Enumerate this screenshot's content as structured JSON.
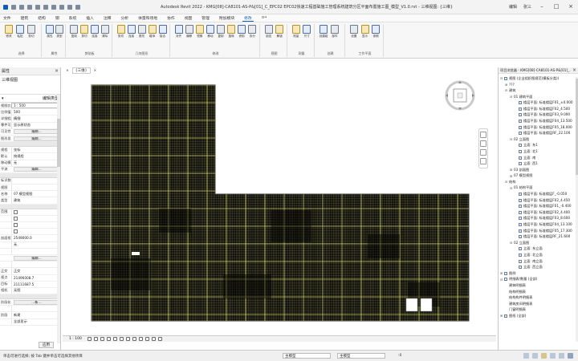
{
  "window": {
    "title": "Autodesk Revit 2022 - KMG[08]-CA8101-AS-P&[01]_C_EPC02 EPC02快速工程基础施工管理系统建筑分区平面布置施工图_模型_V1.0.rvt - 三维视图: {三维}",
    "user": "编辑",
    "user_name": "张三",
    "min": "–",
    "max": "□",
    "close": "×"
  },
  "tabs": [
    "文件",
    "建筑",
    "结构",
    "钢",
    "系统",
    "插入",
    "注释",
    "分析",
    "体量和场地",
    "协作",
    "视图",
    "管理",
    "附加模块",
    "修改",
    "⊙•"
  ],
  "active_tab": "修改",
  "ribbon": {
    "groups": [
      {
        "label": "选择",
        "buttons": [
          "修改",
          "粘贴",
          "剪切"
        ]
      },
      {
        "label": "属性",
        "buttons": [
          "属性",
          "类型"
        ]
      },
      {
        "label": "剪贴板",
        "buttons": [
          "复制",
          "剪切",
          "连接",
          "清除"
        ]
      },
      {
        "label": "几何图形",
        "buttons": [
          "剪切",
          "连接",
          "更改",
          "增添",
          "接合"
        ]
      },
      {
        "label": "修改",
        "buttons": [
          "对齐",
          "偏移",
          "镜像",
          "移动",
          "复制",
          "旋转",
          "修剪",
          "拆分"
        ]
      },
      {
        "label": "视图",
        "buttons": [
          "锁定",
          "解锁"
        ]
      },
      {
        "label": "测量",
        "buttons": [
          "测量",
          "尺寸"
        ]
      },
      {
        "label": "创建",
        "buttons": [
          "创建组",
          "部件"
        ]
      },
      {
        "label": "工作平面",
        "buttons": [
          "设置",
          "显示",
          "参照"
        ]
      }
    ]
  },
  "properties_panel": {
    "title": "属性",
    "type_label": "三维视图",
    "edit_type": "编辑类型",
    "rows": [
      {
        "k": "视图比例",
        "v": "1 : 500",
        "kind": "box"
      },
      {
        "k": "比例值",
        "v": "500",
        "kind": "text"
      },
      {
        "k": "详细程度",
        "v": "精细",
        "kind": "text"
      },
      {
        "k": "零件可见性",
        "v": "显示原状态",
        "kind": "text"
      },
      {
        "k": "可见性",
        "v": "编辑...",
        "kind": "btn"
      },
      {
        "k": "图形显示",
        "v": "编辑...",
        "kind": "btn"
      },
      {
        "k": "",
        "v": "",
        "kind": "section"
      },
      {
        "k": "规程",
        "v": "坐标",
        "kind": "text"
      },
      {
        "k": "默认",
        "v": "按规程",
        "kind": "text"
      },
      {
        "k": "移动模式",
        "v": "无",
        "kind": "text"
      },
      {
        "k": "平流",
        "v": "编辑...",
        "kind": "btn"
      },
      {
        "k": "",
        "v": "",
        "kind": "section"
      },
      {
        "k": "标识数据",
        "v": "",
        "kind": "text"
      },
      {
        "k": "视图",
        "v": "",
        "kind": "text"
      },
      {
        "k": "名称",
        "v": "07 模型视图",
        "kind": "text"
      },
      {
        "k": "类型",
        "v": "建筑",
        "kind": "text"
      },
      {
        "k": "",
        "v": "",
        "kind": "section"
      },
      {
        "k": "范围",
        "v": "",
        "kind": "chk"
      },
      {
        "k": "",
        "v": "",
        "kind": "chk"
      },
      {
        "k": "",
        "v": "",
        "kind": "chk"
      },
      {
        "k": "",
        "v": "",
        "kind": "chk"
      },
      {
        "k": "剖面框",
        "v": "2549000.0",
        "kind": "text"
      },
      {
        "k": "",
        "v": "无",
        "kind": "text"
      },
      {
        "k": "",
        "v": "",
        "kind": "text"
      },
      {
        "k": "",
        "v": "编辑...",
        "kind": "btn"
      },
      {
        "k": "",
        "v": "",
        "kind": "text"
      },
      {
        "k": "正交",
        "v": "正交",
        "kind": "text"
      },
      {
        "k": "视点",
        "v": "21496008.7",
        "kind": "text"
      },
      {
        "k": "目标",
        "v": "21111687.5",
        "kind": "text"
      },
      {
        "k": "相机",
        "v": "无图",
        "kind": "text"
      },
      {
        "k": "",
        "v": "",
        "kind": "section"
      },
      {
        "k": "阶段化",
        "v": "…新…",
        "kind": "btn"
      },
      {
        "k": "",
        "v": "",
        "kind": "text"
      },
      {
        "k": "阶段",
        "v": "新建",
        "kind": "text"
      },
      {
        "k": "",
        "v": "全部显示",
        "kind": "text"
      }
    ],
    "apply": "应用"
  },
  "view_tabs": [
    "×",
    "{三维}",
    "×"
  ],
  "project_browser": {
    "title": "项目浏览器 - KMG[08]-CA8101-AS-P&[01]_...",
    "items": [
      {
        "t": "视图 (企业组织图规范(模板分类))",
        "lvl": 0,
        "tw": "⊟"
      },
      {
        "t": "???",
        "lvl": 1,
        "tw": "⊞"
      },
      {
        "t": "建筑",
        "lvl": 1,
        "tw": "⊟"
      },
      {
        "t": "01 建筑平面",
        "lvl": 2,
        "tw": "⊟"
      },
      {
        "t": "楼层平面: 标准楼层F01_±0.000",
        "lvl": 3,
        "tw": ""
      },
      {
        "t": "楼层平面: 标准楼层F02_4.500",
        "lvl": 3,
        "tw": ""
      },
      {
        "t": "楼层平面: 标准楼层F03_9.000",
        "lvl": 3,
        "tw": ""
      },
      {
        "t": "楼层平面: 标准楼层F04_13.500",
        "lvl": 3,
        "tw": ""
      },
      {
        "t": "楼层平面: 标准楼层F05_18.000",
        "lvl": 3,
        "tw": ""
      },
      {
        "t": "楼层平面: 标准楼层RF_22.100",
        "lvl": 3,
        "tw": ""
      },
      {
        "t": "02 立面图",
        "lvl": 2,
        "tw": "⊟"
      },
      {
        "t": "立面: 东1",
        "lvl": 3,
        "tw": ""
      },
      {
        "t": "立面: 北1",
        "lvl": 3,
        "tw": ""
      },
      {
        "t": "立面: 南",
        "lvl": 3,
        "tw": ""
      },
      {
        "t": "立面: 西1",
        "lvl": 3,
        "tw": ""
      },
      {
        "t": "03 剖面图",
        "lvl": 2,
        "tw": "⊞"
      },
      {
        "t": "07 模型视图",
        "lvl": 2,
        "tw": "⊞"
      },
      {
        "t": "结构",
        "lvl": 1,
        "tw": "⊟"
      },
      {
        "t": "01 结构平面",
        "lvl": 2,
        "tw": "⊟"
      },
      {
        "t": "楼层平面: 标准楼层F_-0.050",
        "lvl": 3,
        "tw": ""
      },
      {
        "t": "楼层平面: 标准楼层F02_4.450",
        "lvl": 3,
        "tw": ""
      },
      {
        "t": "楼层平面: 标准楼层F01_-0.400",
        "lvl": 3,
        "tw": ""
      },
      {
        "t": "楼层平面: 标准楼层F02_4.400",
        "lvl": 3,
        "tw": ""
      },
      {
        "t": "楼层平面: 标准楼层F03_8.600",
        "lvl": 3,
        "tw": ""
      },
      {
        "t": "楼层平面: 标准楼层F04_13.100",
        "lvl": 3,
        "tw": ""
      },
      {
        "t": "楼层平面: 标准楼层F05_17.300",
        "lvl": 3,
        "tw": ""
      },
      {
        "t": "楼层平面: 标准楼层RF_21.600",
        "lvl": 3,
        "tw": ""
      },
      {
        "t": "02 立面图",
        "lvl": 2,
        "tw": "⊟"
      },
      {
        "t": "立面: 东立面",
        "lvl": 3,
        "tw": ""
      },
      {
        "t": "立面: 北立面",
        "lvl": 3,
        "tw": ""
      },
      {
        "t": "立面: 南立面",
        "lvl": 3,
        "tw": ""
      },
      {
        "t": "立面: 西立面",
        "lvl": 3,
        "tw": ""
      },
      {
        "t": "图例",
        "lvl": 0,
        "tw": "⊞"
      },
      {
        "t": "明细表/数量 (全部)",
        "lvl": 0,
        "tw": "⊟"
      },
      {
        "t": "建筑明细表",
        "lvl": 1,
        "tw": ""
      },
      {
        "t": "结构明细表",
        "lvl": 1,
        "tw": ""
      },
      {
        "t": "结构构件明细表",
        "lvl": 1,
        "tw": ""
      },
      {
        "t": "建筑房间明细表",
        "lvl": 1,
        "tw": ""
      },
      {
        "t": "门窗明细表",
        "lvl": 1,
        "tw": ""
      },
      {
        "t": "图纸 (全部)",
        "lvl": 0,
        "tw": "⊞"
      }
    ]
  },
  "view_bar": {
    "scale": "1 : 100"
  },
  "status": {
    "text": "单击可进行选择; 按 Tab 键并单击可选择其他项目",
    "model": "主模型",
    "zero": ":0",
    "workset": "主模型"
  },
  "colors": {
    "accent": "#0a5fb4",
    "plan_bg": "#0b0b0b",
    "plan_line": "#d8d870",
    "ribbon_bg": "#f7f7f7"
  }
}
